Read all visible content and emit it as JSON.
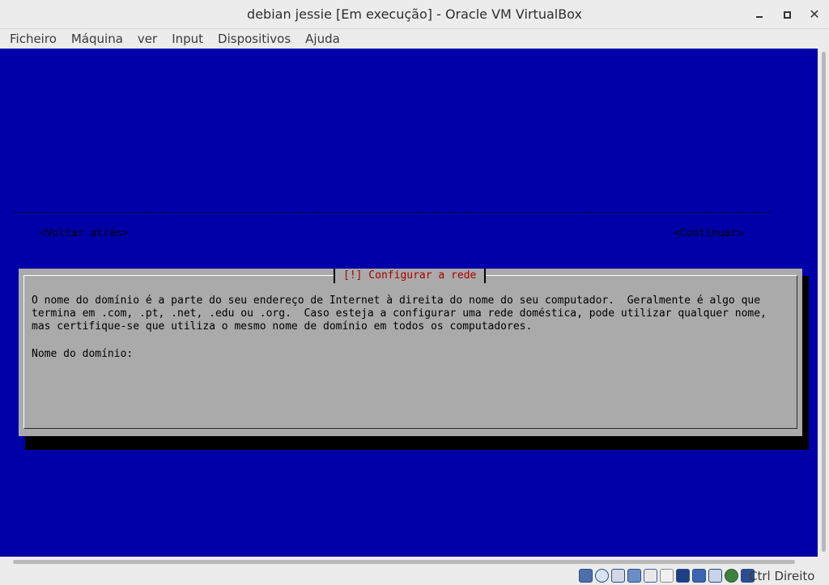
{
  "window": {
    "title": "debian jessie [Em execução] - Oracle VM VirtualBox",
    "controls": {
      "minimize": "minimize-icon",
      "maximize": "maximize-icon",
      "close": "close-icon"
    }
  },
  "menubar": {
    "items": [
      "Ficheiro",
      "Máquina",
      "ver",
      "Input",
      "Dispositivos",
      "Ajuda"
    ]
  },
  "installer": {
    "background_color": "#0000a8",
    "dialog": {
      "title": "[!] Configurar a rede",
      "description": "O nome do domínio é a parte do seu endereço de Internet à direita do nome do seu computador.  Geralmente é algo que\ntermina em .com, .pt, .net, .edu ou .org.  Caso esteja a configurar uma rede doméstica, pode utilizar qualquer nome,\nmas certifique-se que utiliza o mesmo nome de domínio em todos os computadores.",
      "field_label": "Nome do domínio:",
      "field_value": "",
      "back_button": "<Voltar atrás>",
      "continue_button": "<Continuar>"
    }
  },
  "statusbar": {
    "icons": [
      "hard-disk-icon",
      "optical-drive-icon",
      "audio-icon",
      "network-icon",
      "usb-icon",
      "shared-folders-icon",
      "display-icon",
      "video-capture-icon",
      "cpu-icon",
      "mouse-integration-icon",
      "keyboard-capture-icon"
    ],
    "host_key": "Ctrl Direito"
  }
}
